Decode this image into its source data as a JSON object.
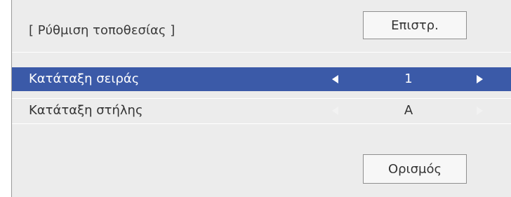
{
  "header": {
    "title": "[ Ρύθμιση τοποθεσίας ]",
    "back_button": "Επιστρ."
  },
  "rows": [
    {
      "label": "Κατάταξη σειράς",
      "value": "1",
      "selected": true
    },
    {
      "label": "Κατάταξη στήλης",
      "value": "A",
      "selected": false
    }
  ],
  "footer": {
    "set_button": "Ορισμός"
  },
  "colors": {
    "panel_background": "#ececec",
    "selection_highlight": "#3b5aa8",
    "selected_text": "#ffffff",
    "button_background": "#f7f7f7"
  },
  "icons": {
    "decrease": "triangle-left-icon",
    "increase": "triangle-right-icon"
  }
}
